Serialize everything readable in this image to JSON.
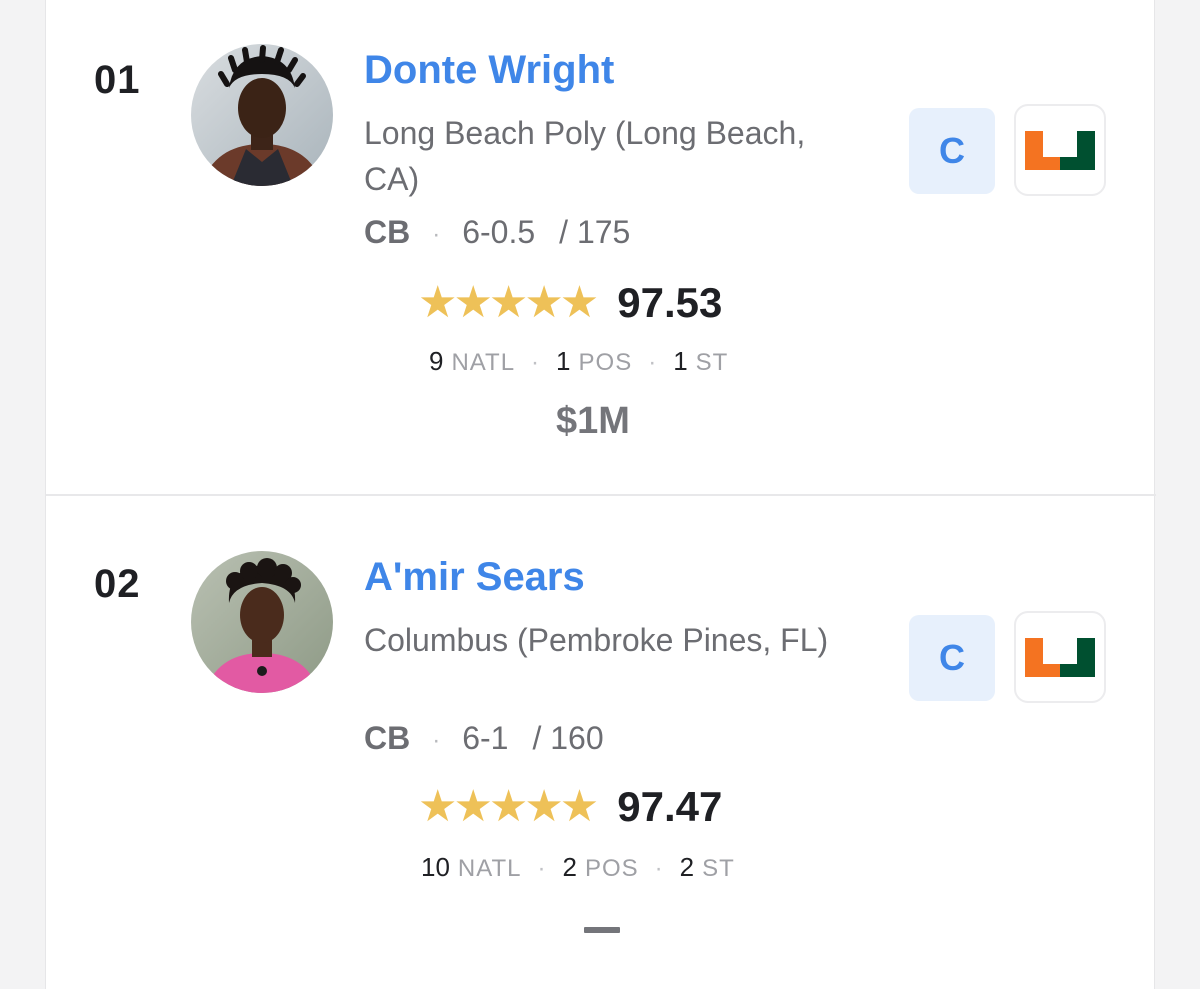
{
  "colors": {
    "name_link": "#3f86e8",
    "star": "#eec158",
    "status_badge_bg": "#e7f0fc",
    "logo_orange": "#f47321",
    "logo_green": "#005030"
  },
  "players": [
    {
      "rank": "01",
      "name": "Donte Wright",
      "school": "Long Beach Poly (Long Beach, CA)",
      "position": "CB",
      "separator": "·",
      "height": "6-0.5",
      "weight": "/ 175",
      "stars": "★★★★★",
      "star_count": 5,
      "rating": "97.53",
      "national_rank": "9",
      "national_label": "NATL",
      "position_rank": "1",
      "position_label": "POS",
      "state_rank": "1",
      "state_label": "ST",
      "rank_separator": "·",
      "nil_value": "$1M",
      "status": "C",
      "team_logo": "miami-u-logo",
      "avatar_icon": "player-photo"
    },
    {
      "rank": "02",
      "name": "A'mir Sears",
      "school": "Columbus (Pembroke Pines, FL)",
      "position": "CB",
      "separator": "·",
      "height": "6-1",
      "weight": "/ 160",
      "stars": "★★★★★",
      "star_count": 5,
      "rating": "97.47",
      "national_rank": "10",
      "national_label": "NATL",
      "position_rank": "2",
      "position_label": "POS",
      "state_rank": "2",
      "state_label": "ST",
      "rank_separator": "·",
      "nil_value": "—",
      "status": "C",
      "team_logo": "miami-u-logo",
      "avatar_icon": "player-photo"
    }
  ]
}
